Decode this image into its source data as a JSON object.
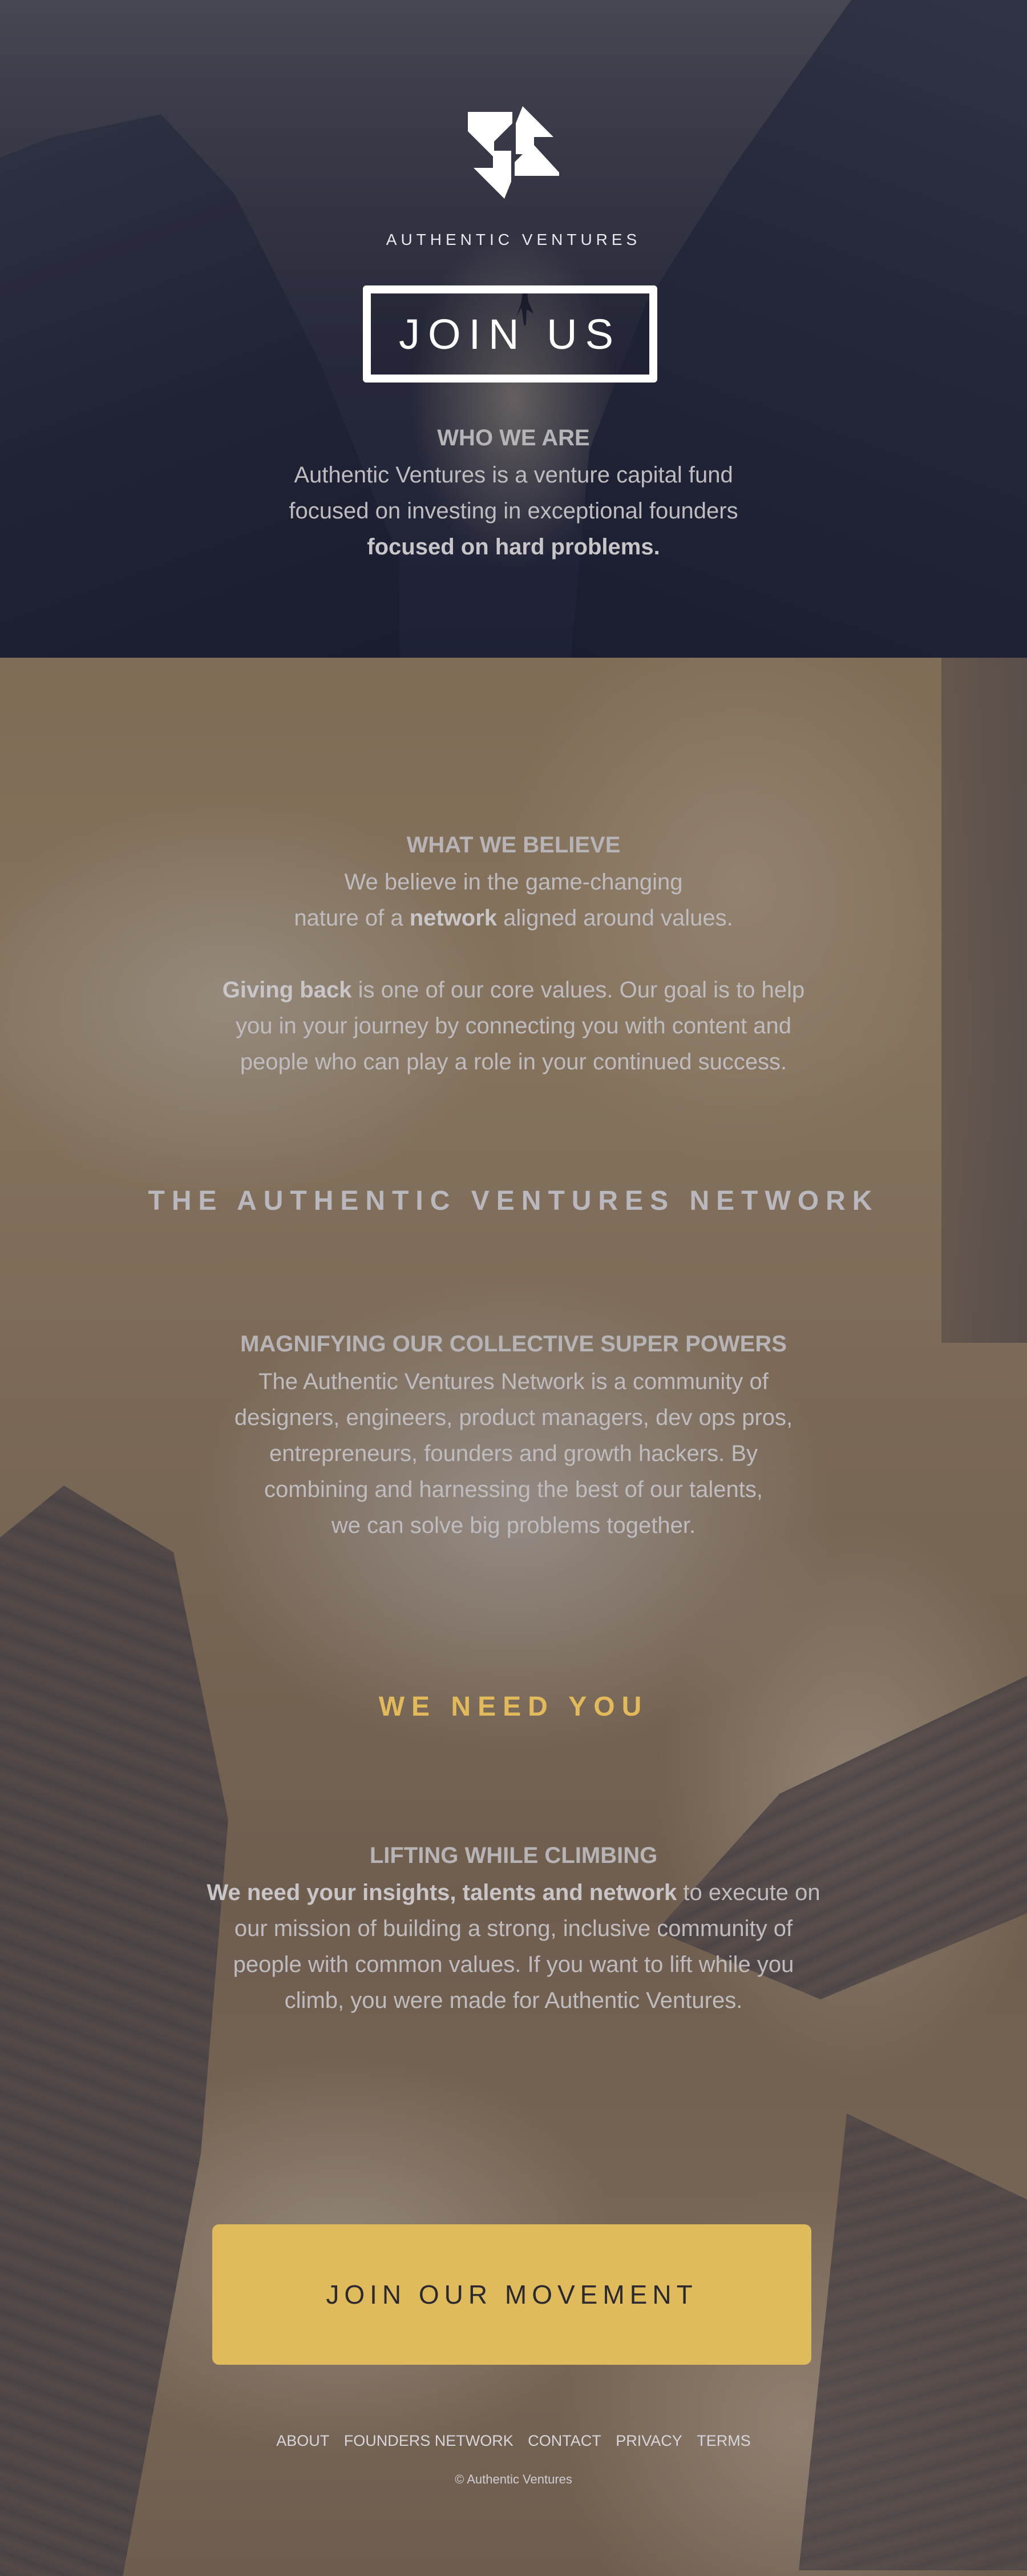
{
  "hero": {
    "brand": "AUTHENTIC VENTURES",
    "join_button": "JOIN US",
    "title": "WHO WE ARE",
    "line1": "Authentic Ventures is a venture capital fund",
    "line2": "focused on investing in exceptional founders",
    "line3": "focused on hard problems."
  },
  "believe": {
    "title": "WHAT WE BELIEVE",
    "line1": "We believe in the game-changing",
    "line2_pre": "nature of a ",
    "line2_bold": "network",
    "line2_post": " aligned around values.",
    "p2_bold": "Giving back",
    "p2_line1_post": " is one of our core values. Our goal is to help",
    "p2_line2": "you in your journey by connecting you with content and",
    "p2_line3": "people who can play a role in your continued success."
  },
  "network": {
    "title": "THE AUTHENTIC VENTURES NETWORK",
    "subtitle": "MAGNIFYING OUR COLLECTIVE SUPER POWERS",
    "line1": "The Authentic Ventures Network is a community of",
    "line2": "designers, engineers, product managers, dev ops pros,",
    "line3": "entrepreneurs, founders and growth hackers. By",
    "line4": "combining and harnessing the best of our talents,",
    "line5": "we can solve big problems together."
  },
  "need": {
    "title": "WE NEED YOU",
    "subtitle": "LIFTING WHILE CLIMBING",
    "line1_bold": "We need your insights, talents and network",
    "line1_post": " to execute on",
    "line2": "our mission of building a strong, inclusive community of",
    "line3": "people with common values. If you want to lift while you",
    "line4": "climb, you were made for Authentic Ventures."
  },
  "cta": {
    "label": "JOIN OUR MOVEMENT"
  },
  "footer": {
    "links": [
      "ABOUT",
      "FOUNDERS NETWORK",
      "CONTACT",
      "PRIVACY",
      "TERMS"
    ],
    "copyright": "© Authentic Ventures"
  },
  "colors": {
    "accent": "#e0bb5c",
    "accent_text": "#e2ba5a"
  },
  "icons": {
    "logo": "pinwheel-logo-icon"
  }
}
